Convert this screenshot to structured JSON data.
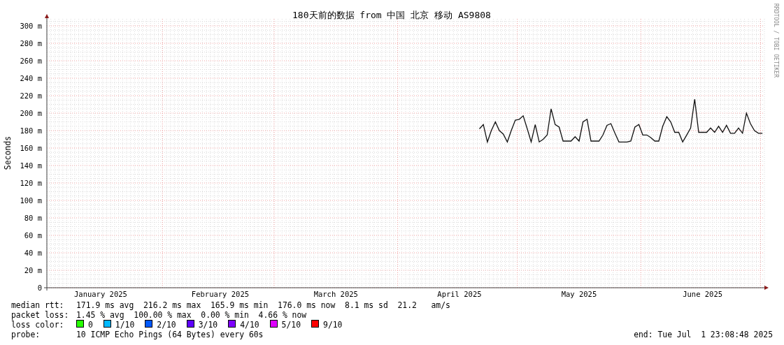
{
  "chart": {
    "side_note": "RRDTOOL / TOBI OETIKER",
    "chart_data": {
      "type": "line",
      "title": "180天前的数据 from 中国 北京 移动 AS9808",
      "ylabel": "Seconds",
      "ylim": [
        0,
        308
      ],
      "grid": true,
      "categories": [
        null,
        null,
        null,
        null,
        null,
        null,
        null,
        null,
        null,
        null,
        null,
        null,
        null,
        "January 2025",
        null,
        null,
        null,
        null,
        null,
        null,
        null,
        null,
        null,
        null,
        null,
        null,
        null,
        null,
        null,
        null,
        null,
        null,
        null,
        null,
        null,
        null,
        null,
        null,
        null,
        null,
        null,
        null,
        null,
        "February 2025",
        null,
        null,
        null,
        null,
        null,
        null,
        null,
        null,
        null,
        null,
        null,
        null,
        null,
        null,
        null,
        null,
        null,
        null,
        null,
        null,
        null,
        null,
        null,
        null,
        null,
        null,
        null,
        null,
        "March 2025",
        null,
        null,
        null,
        null,
        null,
        null,
        null,
        null,
        null,
        null,
        null,
        null,
        null,
        null,
        null,
        null,
        null,
        null,
        null,
        null,
        null,
        null,
        null,
        null,
        null,
        null,
        null,
        null,
        null,
        null,
        "April 2025",
        null,
        null,
        null,
        null,
        null,
        null,
        null,
        null,
        null,
        null,
        null,
        null,
        null,
        null,
        null,
        null,
        null,
        null,
        null,
        null,
        null,
        null,
        null,
        null,
        null,
        null,
        null,
        null,
        null,
        "May 2025",
        null,
        null,
        null,
        null,
        null,
        null,
        null,
        null,
        null,
        null,
        null,
        null,
        null,
        null,
        null,
        null,
        null,
        null,
        null,
        null,
        null,
        null,
        null,
        null,
        null,
        null,
        null,
        null,
        null,
        null,
        "June 2025",
        null,
        null,
        null,
        null,
        null,
        null,
        null,
        null,
        null,
        null,
        null,
        null,
        null,
        null,
        null
      ],
      "yticks": [
        {
          "value": 0,
          "label": "0"
        },
        {
          "value": 20,
          "label": "20 m"
        },
        {
          "value": 40,
          "label": "40 m"
        },
        {
          "value": 60,
          "label": "60 m"
        },
        {
          "value": 80,
          "label": "80 m"
        },
        {
          "value": 100,
          "label": "100 m"
        },
        {
          "value": 120,
          "label": "120 m"
        },
        {
          "value": 140,
          "label": "140 m"
        },
        {
          "value": 160,
          "label": "160 m"
        },
        {
          "value": 180,
          "label": "180 m"
        },
        {
          "value": 200,
          "label": "200 m"
        },
        {
          "value": 220,
          "label": "220 m"
        },
        {
          "value": 240,
          "label": "240 m"
        },
        {
          "value": 260,
          "label": "260 m"
        },
        {
          "value": 280,
          "label": "280 m"
        },
        {
          "value": 300,
          "label": "300 m"
        }
      ],
      "series": [
        {
          "color": "#111111",
          "values": [
            null,
            null,
            null,
            null,
            null,
            null,
            null,
            null,
            null,
            null,
            null,
            null,
            null,
            null,
            null,
            null,
            null,
            null,
            null,
            null,
            null,
            null,
            null,
            null,
            null,
            null,
            null,
            null,
            null,
            null,
            null,
            null,
            null,
            null,
            null,
            null,
            null,
            null,
            null,
            null,
            null,
            null,
            null,
            null,
            null,
            null,
            null,
            null,
            null,
            null,
            null,
            null,
            null,
            null,
            null,
            null,
            null,
            null,
            null,
            null,
            null,
            null,
            null,
            null,
            null,
            null,
            null,
            null,
            null,
            null,
            null,
            null,
            null,
            null,
            null,
            null,
            null,
            null,
            null,
            null,
            null,
            null,
            null,
            null,
            null,
            null,
            null,
            null,
            null,
            null,
            null,
            null,
            null,
            null,
            null,
            null,
            null,
            null,
            null,
            null,
            null,
            null,
            null,
            null,
            null,
            null,
            null,
            null,
            182,
            187,
            167,
            180,
            190,
            180,
            176,
            167,
            180,
            192,
            193,
            197,
            182,
            167,
            187,
            167,
            170,
            175,
            205,
            187,
            184,
            168,
            168,
            168,
            173,
            168,
            190,
            193,
            168,
            168,
            168,
            175,
            186,
            188,
            177,
            167,
            167,
            167,
            168,
            184,
            187,
            175,
            175,
            172,
            168,
            168,
            185,
            196,
            190,
            178,
            178,
            167,
            175,
            183,
            216,
            178,
            178,
            178,
            183,
            178,
            185,
            178,
            186,
            177,
            177,
            183,
            177,
            200,
            188,
            180,
            177,
            177
          ]
        }
      ]
    }
  },
  "stats": [
    {
      "label": "median rtt:",
      "text": "171.9 ms avg  216.2 ms max  165.9 ms min  176.0 ms now  8.1 ms sd  21.2   am/s"
    },
    {
      "label": "packet loss:",
      "text": "1.45 % avg  100.00 % max  0.00 % min  4.66 % now"
    }
  ],
  "loss_colors": {
    "label": "loss color:",
    "items": [
      {
        "label": "0",
        "color": "#26ff00"
      },
      {
        "label": "1/10",
        "color": "#00b8ff"
      },
      {
        "label": "2/10",
        "color": "#0059ff"
      },
      {
        "label": "3/10",
        "color": "#5e00ff"
      },
      {
        "label": "4/10",
        "color": "#7e00ff"
      },
      {
        "label": "5/10",
        "color": "#dd00ff"
      },
      {
        "label": "9/10",
        "color": "#ff0000"
      }
    ]
  },
  "probe": {
    "label": "probe:",
    "text": "10 ICMP Echo Pings (64 Bytes) every 60s",
    "end": "end: Tue Jul  1 23:08:48 2025"
  }
}
